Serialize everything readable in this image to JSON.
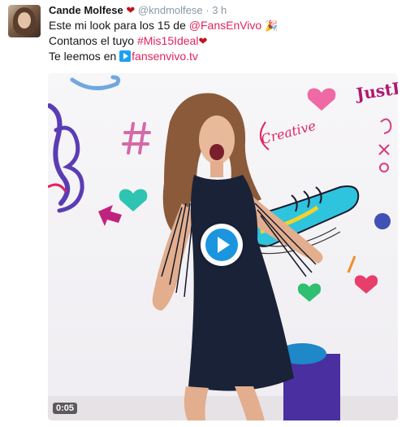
{
  "tweet": {
    "author_name": "Cande Molfese",
    "author_badge_icon": "heart-emoji-icon",
    "handle": "@kndmolfese",
    "separator": "·",
    "time": "3 h",
    "lines": {
      "l1_prefix": "Este mi look para los 15 de ",
      "l1_mention": "@FansEnVivo",
      "l1_emoji": "🎉",
      "l2_prefix": "Contanos el tuyo ",
      "l2_hashtag": "#Mis15Ideal",
      "l2_emoji": "❤",
      "l3_prefix": "Te leemos en ",
      "l3_link": "fansenvivo.tv"
    },
    "colors": {
      "link": "#e0245e",
      "play_accent": "#1b95e0",
      "handle": "#8899a6"
    }
  },
  "video": {
    "duration": "0:05",
    "play_icon": "play-circle-icon",
    "wall_texts": {
      "brand": "JustD",
      "creative": "Creative"
    }
  }
}
